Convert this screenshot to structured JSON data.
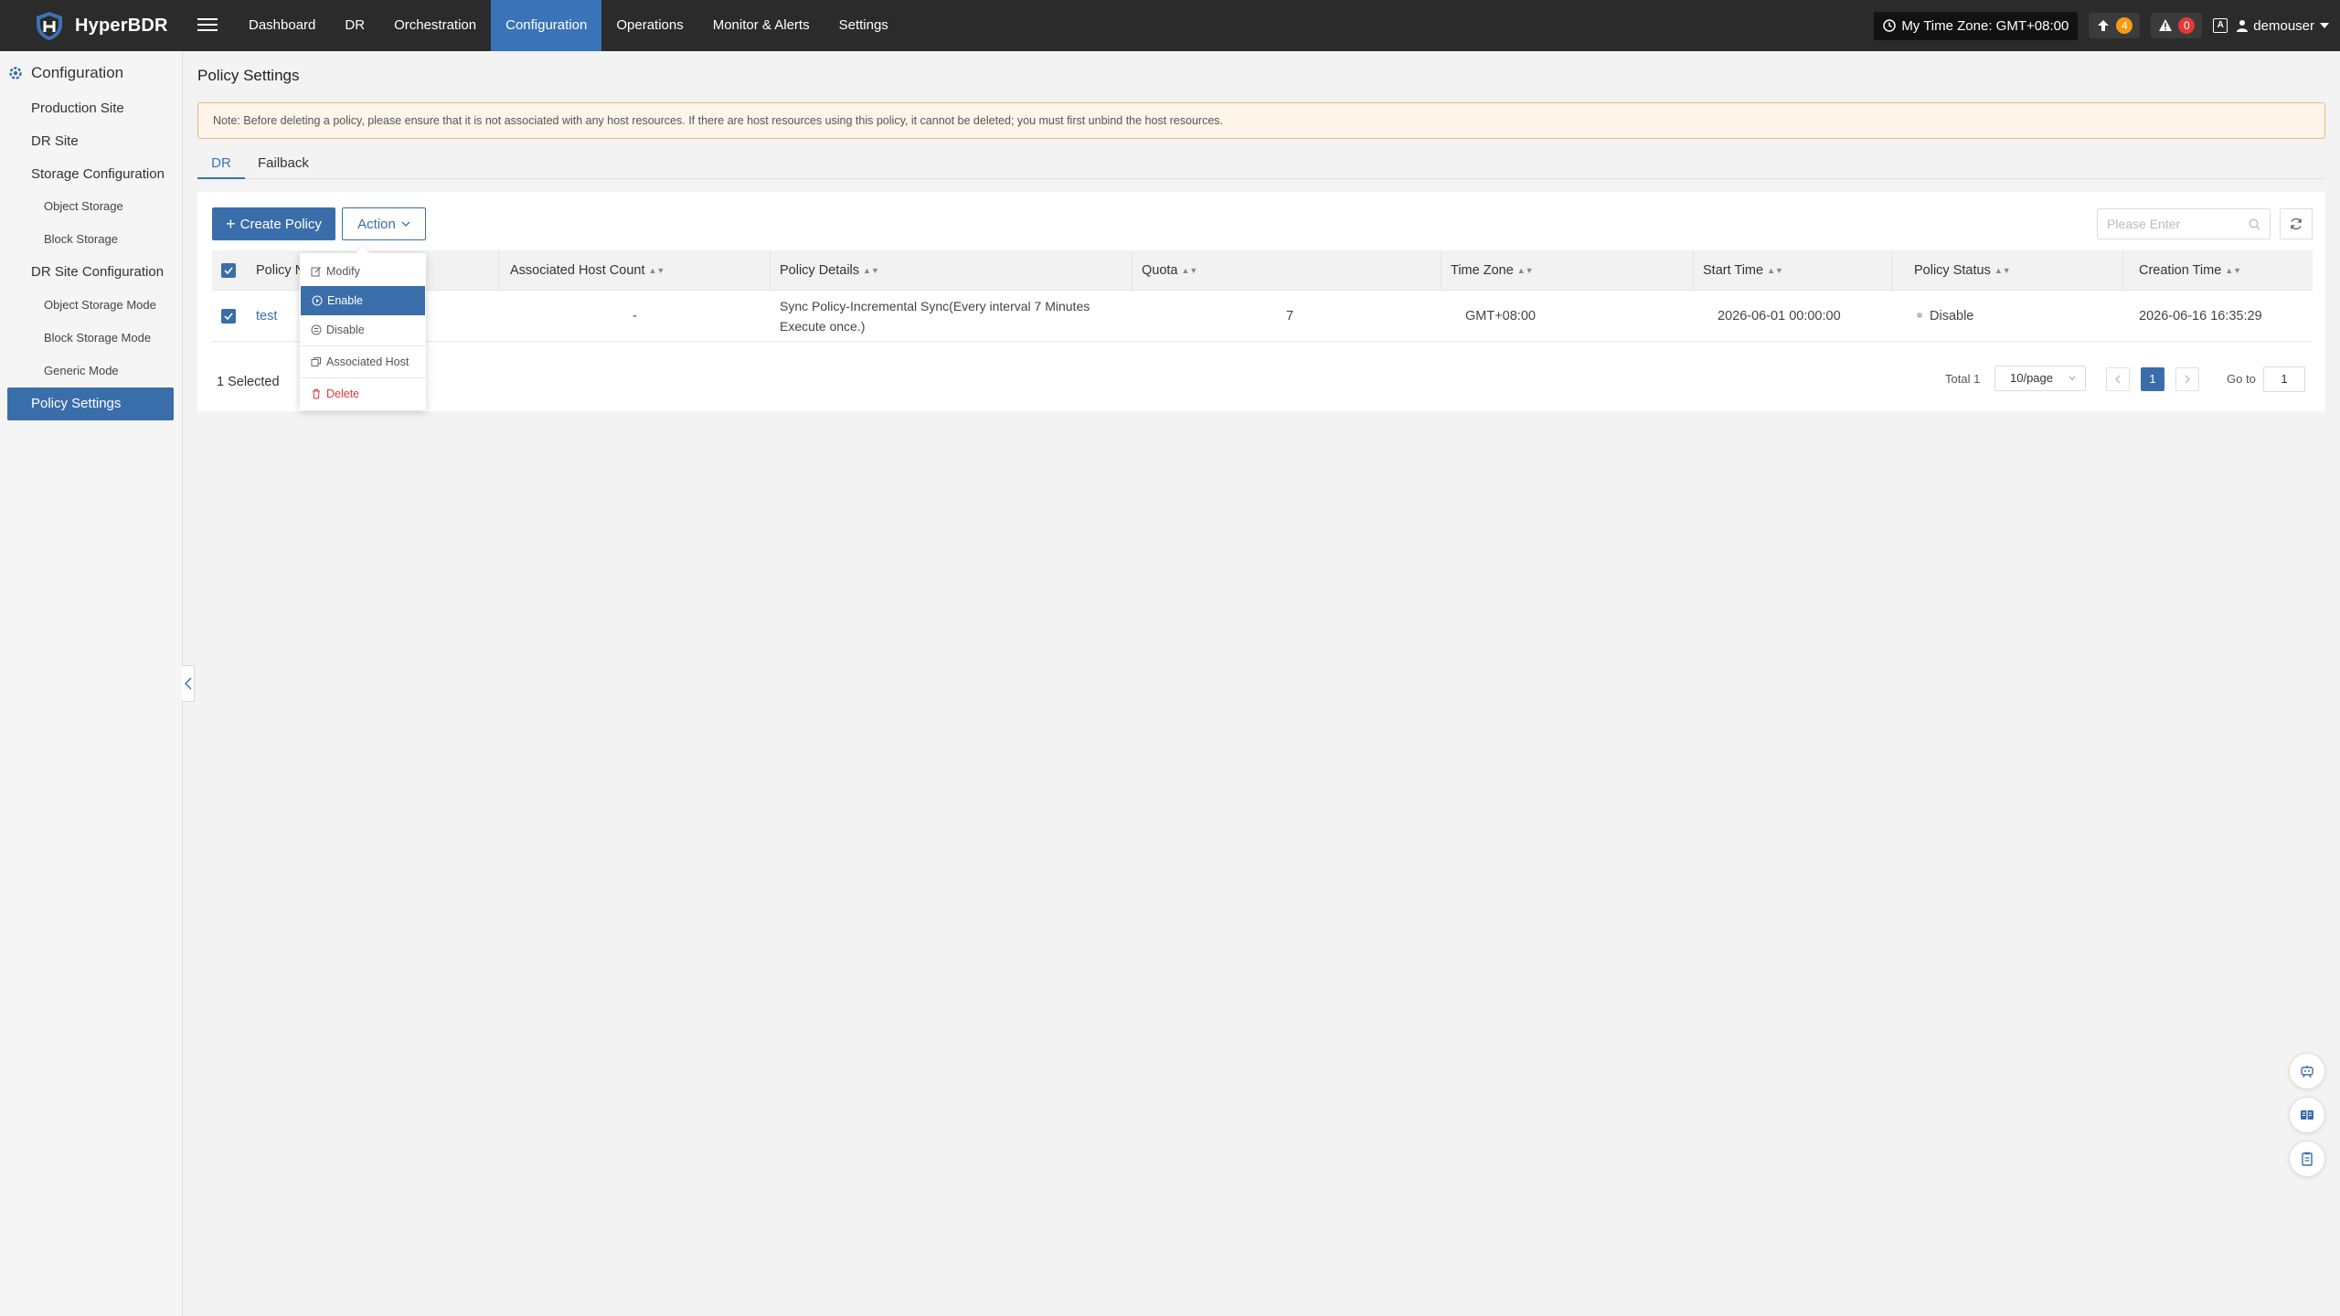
{
  "app": {
    "name": "HyperBDR"
  },
  "nav": {
    "items": [
      {
        "label": "Dashboard"
      },
      {
        "label": "DR"
      },
      {
        "label": "Orchestration"
      },
      {
        "label": "Configuration"
      },
      {
        "label": "Operations"
      },
      {
        "label": "Monitor & Alerts"
      },
      {
        "label": "Settings"
      }
    ],
    "active_index": 3
  },
  "topright": {
    "timezone": "My Time Zone: GMT+08:00",
    "tasks_count": "4",
    "alerts_count": "0",
    "username": "demouser"
  },
  "sidebar": {
    "title": "Configuration",
    "items": [
      {
        "label": "Production Site"
      },
      {
        "label": "DR Site"
      },
      {
        "label": "Storage Configuration"
      },
      {
        "label": "Object Storage"
      },
      {
        "label": "Block Storage"
      },
      {
        "label": "DR Site Configuration"
      },
      {
        "label": "Object Storage Mode"
      },
      {
        "label": "Block Storage Mode"
      },
      {
        "label": "Generic Mode"
      },
      {
        "label": "Policy Settings"
      }
    ]
  },
  "page": {
    "title": "Policy Settings",
    "notice": "Note: Before deleting a policy, please ensure that it is not associated with any host resources. If there are host resources using this policy, it cannot be deleted; you must first unbind the host resources.",
    "tabs": [
      {
        "label": "DR"
      },
      {
        "label": "Failback"
      }
    ],
    "active_tab": 0
  },
  "toolbar": {
    "create_label": "Create Policy",
    "action_label": "Action",
    "search_placeholder": "Please Enter"
  },
  "table": {
    "columns": [
      {
        "label": "Policy N"
      },
      {
        "label": "Associated Host Count"
      },
      {
        "label": "Policy Details"
      },
      {
        "label": "Quota"
      },
      {
        "label": "Time Zone"
      },
      {
        "label": "Start Time"
      },
      {
        "label": "Policy Status"
      },
      {
        "label": "Creation Time"
      }
    ],
    "rows": [
      {
        "name": "test",
        "host_count": "-",
        "details_line1": "Sync Policy-Incremental Sync(Every interval 7 Minutes",
        "details_line2": "Execute once.)",
        "quota": "7",
        "time_zone": "GMT+08:00",
        "start_time": "2026-06-01 00:00:00",
        "status": "Disable",
        "creation_time": "2026-06-16 16:35:29",
        "selected": true
      }
    ]
  },
  "footer": {
    "selected_text": "1 Selected",
    "total_text": "Total 1",
    "page_size": "10/page",
    "current_page": "1",
    "goto_label": "Go to",
    "goto_value": "1"
  },
  "dropdown": {
    "items": [
      {
        "label": "Modify",
        "icon": "edit-icon"
      },
      {
        "label": "Enable",
        "icon": "play-circle-icon"
      },
      {
        "label": "Disable",
        "icon": "disable-icon"
      },
      {
        "label": "Associated Host",
        "icon": "copy-icon"
      },
      {
        "label": "Delete",
        "icon": "trash-icon"
      }
    ],
    "highlighted_index": 1
  },
  "colors": {
    "topbar": "#2b2b2b",
    "accent": "#3a6eaa",
    "danger": "#e53935",
    "warning": "#f39c12"
  }
}
